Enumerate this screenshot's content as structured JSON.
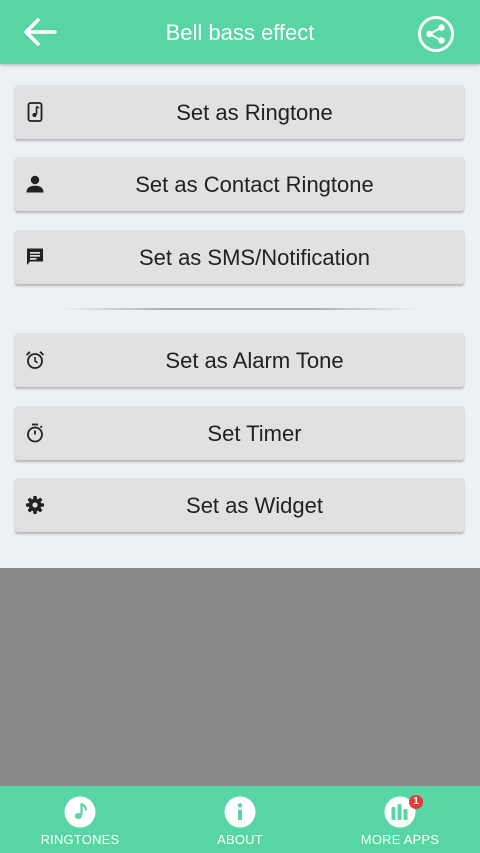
{
  "header": {
    "title": "Bell bass effect",
    "back_icon": "arrow-left-icon",
    "share_icon": "share-icon"
  },
  "actions": {
    "ringtone": {
      "label": "Set as Ringtone",
      "icon": "music-file-icon"
    },
    "contact": {
      "label": "Set as Contact Ringtone",
      "icon": "person-icon"
    },
    "sms": {
      "label": "Set as SMS/Notification",
      "icon": "message-icon"
    },
    "alarm": {
      "label": "Set as Alarm Tone",
      "icon": "alarm-clock-icon"
    },
    "timer": {
      "label": "Set Timer",
      "icon": "stopwatch-icon"
    },
    "widget": {
      "label": "Set as Widget",
      "icon": "gear-icon"
    }
  },
  "bottom_nav": {
    "ringtones": {
      "label": "RINGTONES",
      "icon": "music-note-icon"
    },
    "about": {
      "label": "ABOUT",
      "icon": "info-icon"
    },
    "more_apps": {
      "label": "MORE APPS",
      "icon": "apps-icon",
      "badge": "1"
    }
  },
  "colors": {
    "accent": "#57d6a3",
    "button_bg": "#e1e1e1",
    "content_bg": "#eef1f4",
    "ad_area": "#898989",
    "badge": "#e53935"
  }
}
